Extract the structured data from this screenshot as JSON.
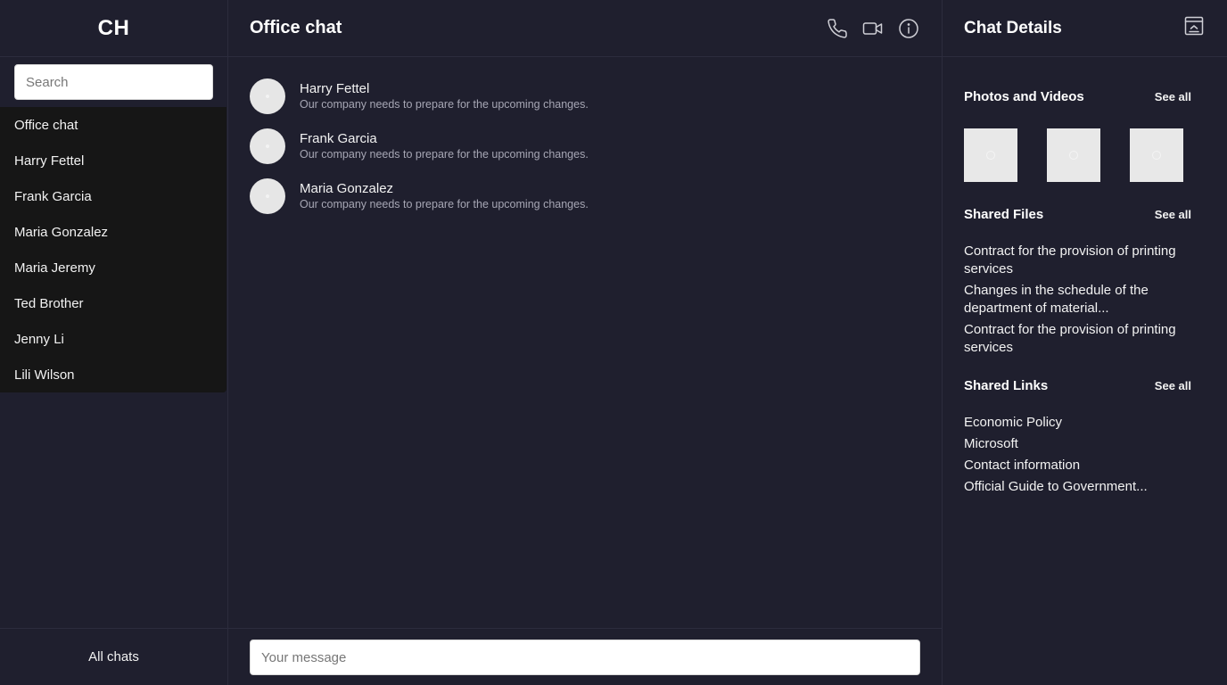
{
  "sidebar": {
    "brand": "CH",
    "search_placeholder": "Search",
    "chats": [
      {
        "label": "Office chat"
      },
      {
        "label": "Harry Fettel"
      },
      {
        "label": "Frank Garcia"
      },
      {
        "label": "Maria Gonzalez"
      },
      {
        "label": "Maria Jeremy"
      },
      {
        "label": "Ted Brother"
      },
      {
        "label": "Jenny Li"
      },
      {
        "label": "Lili Wilson"
      }
    ],
    "footer_label": "All chats"
  },
  "main": {
    "title": "Office chat",
    "icons": [
      "phone-icon",
      "video-icon",
      "info-icon"
    ],
    "messages": [
      {
        "name": "Harry Fettel",
        "text": "Our company needs to prepare for the upcoming changes."
      },
      {
        "name": "Frank Garcia",
        "text": "Our company needs to prepare for the upcoming changes."
      },
      {
        "name": "Maria Gonzalez",
        "text": "Our company needs to prepare for the upcoming changes."
      }
    ],
    "composer_placeholder": "Your message"
  },
  "details": {
    "title": "Chat Details",
    "collapse_icon": "collapse-panel-icon",
    "photos": {
      "title": "Photos and Videos",
      "see_all": "See all"
    },
    "files": {
      "title": "Shared Files",
      "see_all": "See all",
      "items": [
        "Contract for the provision of printing services",
        "Changes in the schedule of the department of material...",
        "Contract for the provision of printing services"
      ]
    },
    "links": {
      "title": "Shared Links",
      "see_all": "See all",
      "items": [
        "Economic Policy",
        "Microsoft",
        "Contact information",
        "Official Guide to Government..."
      ]
    }
  },
  "colors": {
    "background": "#1f1f2e",
    "chat_list_bg": "#161616",
    "border": "#2c2c3d",
    "avatar": "#e6e6e6"
  }
}
